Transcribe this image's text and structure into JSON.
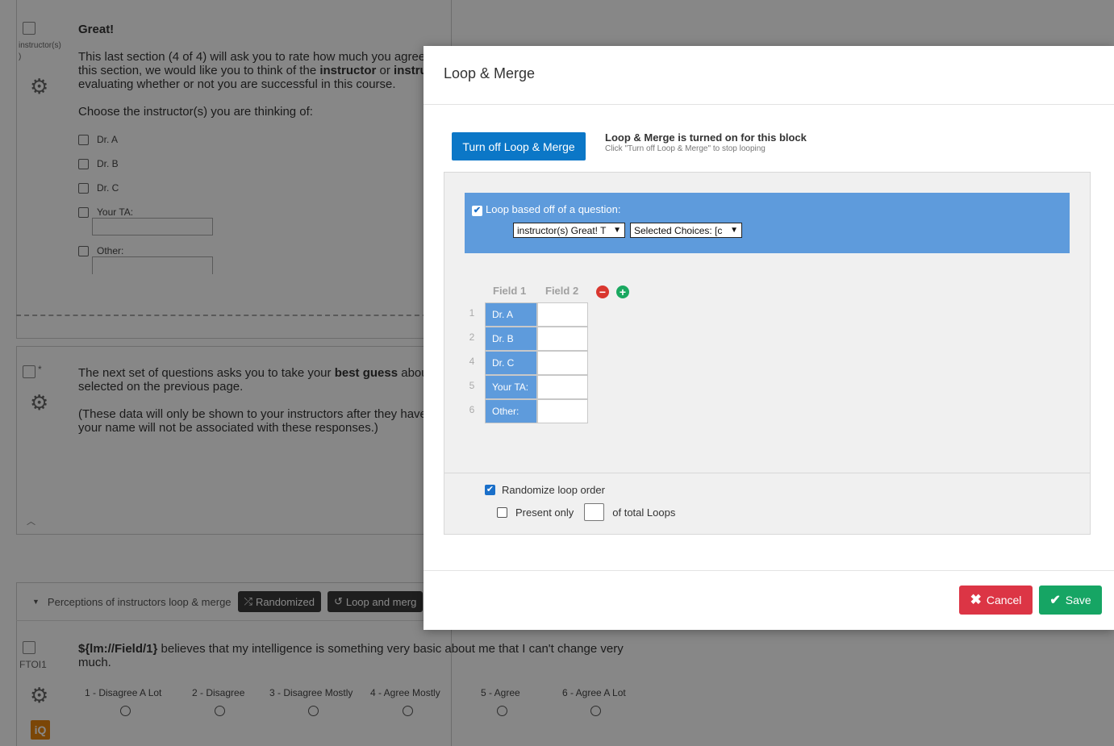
{
  "background": {
    "q1": {
      "id_label": "instructor(s)",
      "title": "Great!",
      "paragraph1_pre": "This last section (4 of 4) will ask you to rate how much you agree",
      "paragraph1_line2_pre": "this section, we would like you to think of the ",
      "paragraph1_bold1": "instructor",
      "paragraph1_mid": " or ",
      "paragraph1_bold2": "instru",
      "paragraph1_line3": "evaluating whether or not you are successful in this course.",
      "prompt": "Choose the instructor(s) you are thinking of:",
      "choices": [
        "Dr. A",
        "Dr. B",
        "Dr. C",
        "Your TA:",
        "Other:"
      ]
    },
    "q2": {
      "id_label": "*",
      "line1_pre": "The next set of questions asks you to take your ",
      "line1_bold": "best guess",
      "line1_post": " abou",
      "line2": "selected on the previous page.",
      "line3": "(These data will only be shown to your instructors after they have",
      "line4": "your name will not be associated with these responses.)"
    },
    "block": {
      "name": "Perceptions of instructors loop & merge",
      "randomized_label": "Randomized",
      "loop_label": "Loop and merg"
    },
    "q3": {
      "id_label": "FTOI1",
      "text_bold": "${lm://Field/1}",
      "text_line1": " believes that my intelligence is something very basic about me that I can't change very",
      "text_line2": "much.",
      "scale": [
        "1 - Disagree A Lot",
        "2 - Disagree",
        "3 - Disagree Mostly",
        "4 - Agree Mostly",
        "5 - Agree",
        "6 - Agree A Lot"
      ]
    },
    "iq_badge": "iQ"
  },
  "modal": {
    "title": "Loop & Merge",
    "turn_off_button": "Turn off Loop & Merge",
    "status_heading": "Loop & Merge is turned on for this block",
    "status_sub": "Click \"Turn off Loop & Merge\" to stop looping",
    "loop_based_label": "Loop based off of a question:",
    "question_select": "instructor(s) Great! T",
    "choices_select": "Selected Choices: [c",
    "field_headers": [
      "Field 1",
      "Field 2"
    ],
    "rows": [
      {
        "num": "1",
        "field1": "Dr. A",
        "field2": ""
      },
      {
        "num": "2",
        "field1": "Dr. B",
        "field2": ""
      },
      {
        "num": "4",
        "field1": "Dr. C",
        "field2": ""
      },
      {
        "num": "5",
        "field1": "Your TA:",
        "field2": ""
      },
      {
        "num": "6",
        "field1": "Other:",
        "field2": ""
      }
    ],
    "randomize_label": "Randomize loop order",
    "randomize_checked": true,
    "present_only_label": "Present only",
    "present_only_checked": false,
    "present_count": "",
    "of_total_label": "of total Loops",
    "cancel_label": "Cancel",
    "save_label": "Save"
  },
  "colors": {
    "primary": "#0b77c7",
    "loop_blue": "#5e9bdc",
    "cancel_red": "#dc3545",
    "save_green": "#16a564",
    "remove_red": "#d9372f",
    "add_green": "#1aa860"
  }
}
